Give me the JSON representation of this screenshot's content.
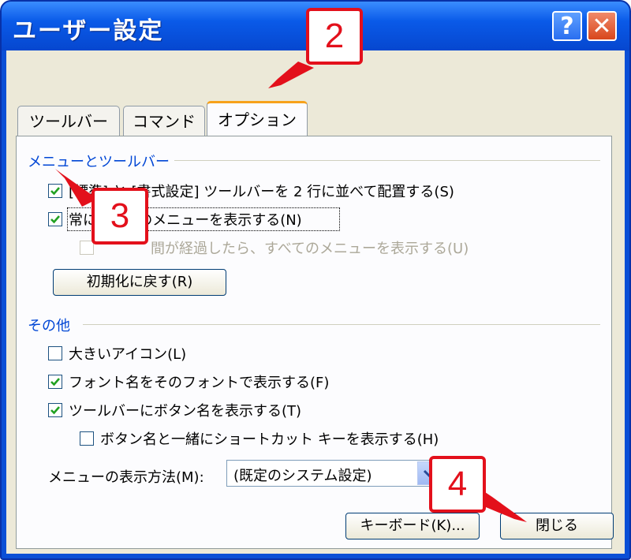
{
  "window": {
    "title": "ユーザー設定",
    "help_label": "?",
    "close_label": "✕"
  },
  "tabs": [
    {
      "label": "ツールバー",
      "active": false
    },
    {
      "label": "コマンド",
      "active": false
    },
    {
      "label": "オプション",
      "active": true
    }
  ],
  "menus_toolbars": {
    "heading": "メニューとツールバー",
    "options": [
      {
        "label": "[標準] と [書式設定] ツールバーを 2 行に並べて配置する(S)",
        "checked": true,
        "enabled": true
      },
      {
        "label": "常にすべてのメニューを表示する(N)",
        "checked": true,
        "enabled": true
      },
      {
        "label": "間が経過したら、すべてのメニューを表示する(U)",
        "checked": false,
        "enabled": false
      }
    ],
    "reset_button": "初期化に戻す(R)"
  },
  "other": {
    "heading": "その他",
    "options": [
      {
        "label": "大きいアイコン(L)",
        "checked": false
      },
      {
        "label": "フォント名をそのフォントで表示する(F)",
        "checked": true
      },
      {
        "label": "ツールバーにボタン名を表示する(T)",
        "checked": true
      },
      {
        "label": "ボタン名と一緒にショートカット キーを表示する(H)",
        "checked": false
      }
    ],
    "menu_animation_label": "メニューの表示方法(M):",
    "menu_animation_value": "(既定のシステム設定)"
  },
  "footer": {
    "keyboard_button": "キーボード(K)...",
    "close_button": "閉じる"
  },
  "callouts": [
    "2",
    "3",
    "4"
  ],
  "colors": {
    "callout": "#e3101b",
    "titlebar": "#0a5ae8",
    "section": "#0046d5"
  }
}
